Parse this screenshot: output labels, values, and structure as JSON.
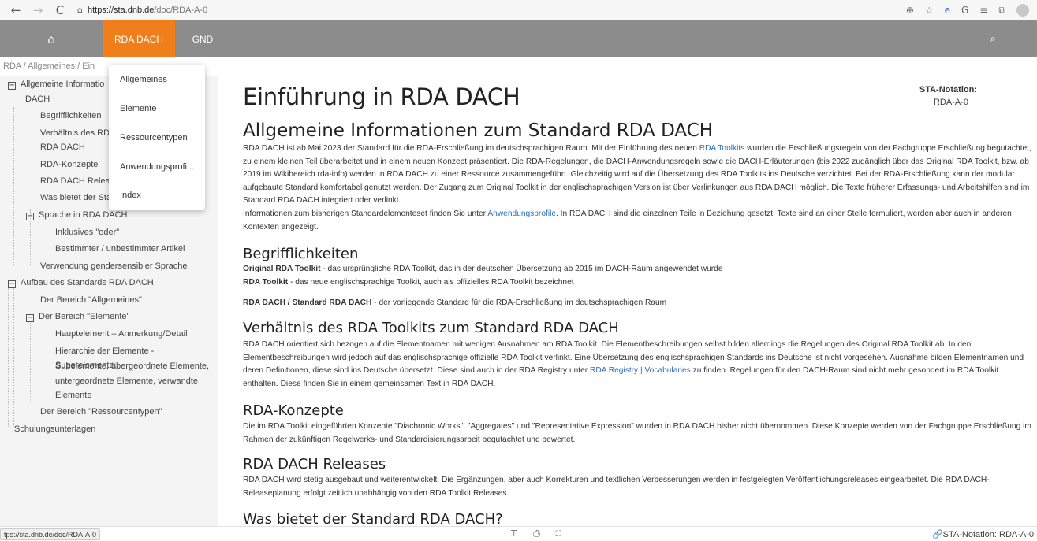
{
  "browser": {
    "back_icon": "←",
    "forward_icon": "→",
    "reload_icon": "C",
    "lock_icon": "🔒",
    "url_host": "https://sta.dnb.de",
    "url_path": "/doc/RDA-A-0",
    "zoom_icon": "⊕",
    "favorites_icon": "☆",
    "extension_icon": "e",
    "extension2_icon": "G",
    "collections_icon": "≡",
    "tabs_icon": "⧉"
  },
  "topnav": {
    "home_icon": "⌂",
    "tab_rda": "RDA DACH",
    "tab_gnd": "GND",
    "search_icon": "🔍",
    "accent": "#f07e1b",
    "bg": "#8c8c8c"
  },
  "breadcrumb": "RDA / Allgemeines / Ein",
  "dropdown": {
    "items": [
      "Allgemeines",
      "Elemente",
      "Ressourcentypen",
      "Anwendungsprofi...",
      "Index"
    ]
  },
  "sidebar": {
    "items": [
      {
        "label": "Allgemeine Informatio"
      },
      {
        "label": "DACH"
      },
      {
        "label": "Begrifflichkeiten"
      },
      {
        "label": "Verhältnis des RD/"
      },
      {
        "label": "RDA DACH"
      },
      {
        "label": "RDA-Konzepte"
      },
      {
        "label": "RDA DACH Releas"
      },
      {
        "label": "Was bietet der Sta"
      },
      {
        "label": "Sprache in RDA DACH"
      },
      {
        "label": "Inklusives \"oder\""
      },
      {
        "label": "Bestimmter / unbestimmter Artikel"
      },
      {
        "label": "Verwendung gendersensibler Sprache"
      },
      {
        "label": "Aufbau des Standards RDA DACH"
      },
      {
        "label": "Der Bereich \"Allgemeines\""
      },
      {
        "label": "Der Bereich \"Elemente\""
      },
      {
        "label": "Hauptelement – Anmerkung/Detail"
      },
      {
        "label": "Hierarchie der Elemente - Superelemente,"
      },
      {
        "label": "Subelemente, übergeordnete Elemente,"
      },
      {
        "label": "untergeordnete Elemente, verwandte"
      },
      {
        "label": "Elemente"
      },
      {
        "label": "Der Bereich \"Ressourcentypen\""
      },
      {
        "label": "Schulungsunterlagen"
      }
    ],
    "toggle_symbol": "−"
  },
  "main": {
    "title": "Einführung in RDA DACH",
    "sta_label": "STA-Notation:",
    "sta_value": "RDA-A-0",
    "s1": {
      "heading": "Allgemeine Informationen zum Standard RDA DACH",
      "p1_a": "RDA DACH ist ab Mai 2023 der Standard für die RDA-Erschließung im deutschsprachigen Raum. Mit der Einführung des neuen ",
      "p1_link": "RDA Toolkits",
      "p1_b": " wurden die Erschließungsregeln von der Fachgruppe Erschließung begutachtet, zu einem kleinen Teil überarbeitet und in einem neuen Konzept präsentiert. Die RDA-Regelungen, die DACH-Anwendungsregeln sowie die DACH-Erläuterungen (bis 2022 zugänglich über das Original RDA Toolkit, bzw. ab 2019 im Wikibereich rda-info) werden in RDA DACH zu einer Ressource zusammengeführt. Gleichzeitig wird auf die Übersetzung des RDA Toolkits ins Deutsche verzichtet. Bei der RDA-Erschließung kann der modular aufgebaute Standard komfortabel genutzt werden. Der Zugang zum Original Toolkit in der englischsprachigen Version ist über Verlinkungen aus RDA DACH möglich. Die Texte früherer Erfassungs- und Arbeitshilfen sind im Standard RDA DACH integriert oder verlinkt.",
      "p2_a": "Informationen zum bisherigen Standardelementeset finden Sie unter ",
      "p2_link": "Anwendungsprofile",
      "p2_b": ". In RDA DACH sind die einzelnen Teile in Beziehung gesetzt; Texte sind an einer Stelle formuliert, werden aber auch in anderen Kontexten angezeigt."
    },
    "s2": {
      "heading": "Begrifflichkeiten",
      "t1_bold": "Original RDA Toolkit",
      "t1_rest": " - das ursprüngliche RDA Toolkit, das in der deutschen Übersetzung ab 2015 im DACH-Raum angewendet wurde",
      "t2_bold": "RDA Toolkit",
      "t2_rest": " - das neue englischsprachige Toolkit, auch als offizielles RDA Toolkit bezeichnet",
      "t3_bold": "RDA DACH / Standard RDA DACH",
      "t3_rest": " - der vorliegende Standard für die RDA-Erschließung im deutschsprachigen Raum"
    },
    "s3": {
      "heading": "Verhältnis des RDA Toolkits zum Standard RDA DACH",
      "p_a": "RDA DACH orientiert sich bezogen auf die Elementnamen mit wenigen Ausnahmen am RDA Toolkit. Die Elementbeschreibungen selbst bilden allerdings die Regelungen des Original RDA Toolkit ab. In den Elementbeschreibungen wird jedoch auf das englischsprachige offizielle RDA Toolkit verlinkt. Eine Übersetzung des englischsprachigen Standards ins Deutsche ist nicht vorgesehen. Ausnahme bilden Elementnamen und deren Definitionen, diese sind ins Deutsche übersetzt. Diese sind auch in der RDA Registry unter ",
      "p_link": "RDA Registry | Vocabularies",
      "p_b": " zu finden. Regelungen für den DACH-Raum sind nicht mehr gesondert im RDA Toolkit enthalten. Diese finden Sie in einem gemeinsamen Text in RDA DACH."
    },
    "s4": {
      "heading": "RDA-Konzepte",
      "p": "Die im RDA Toolkit eingeführten Konzepte \"Diachronic Works\", \"Aggregates\" und \"Representative Expression\" wurden in RDA DACH bisher nicht übernommen. Diese Konzepte werden von der Fachgruppe Erschließung im Rahmen der zukünftigen Regelwerks- und Standardisierungsarbeit begutachtet und bewertet."
    },
    "s5": {
      "heading": "RDA DACH Releases",
      "p": "RDA DACH wird stetig ausgebaut und weiterentwickelt. Die Ergänzungen, aber auch Korrekturen und textlichen Verbesserungen werden in festgelegten Veröffentlichungsreleases eingearbeitet. Die RDA DACH-Releaseplanung erfolgt zeitlich unabhängig von den RDA Toolkit Releases."
    },
    "s6": {
      "heading": "Was bietet der Standard RDA DACH?"
    }
  },
  "statusbar": {
    "url_hint": "tps://sta.dnb.de/doc/RDA-A-0",
    "tools": "⊤ ⎙ ⛶",
    "notation": "STA-Notation: RDA-A-0",
    "link_icon": "🔗"
  }
}
